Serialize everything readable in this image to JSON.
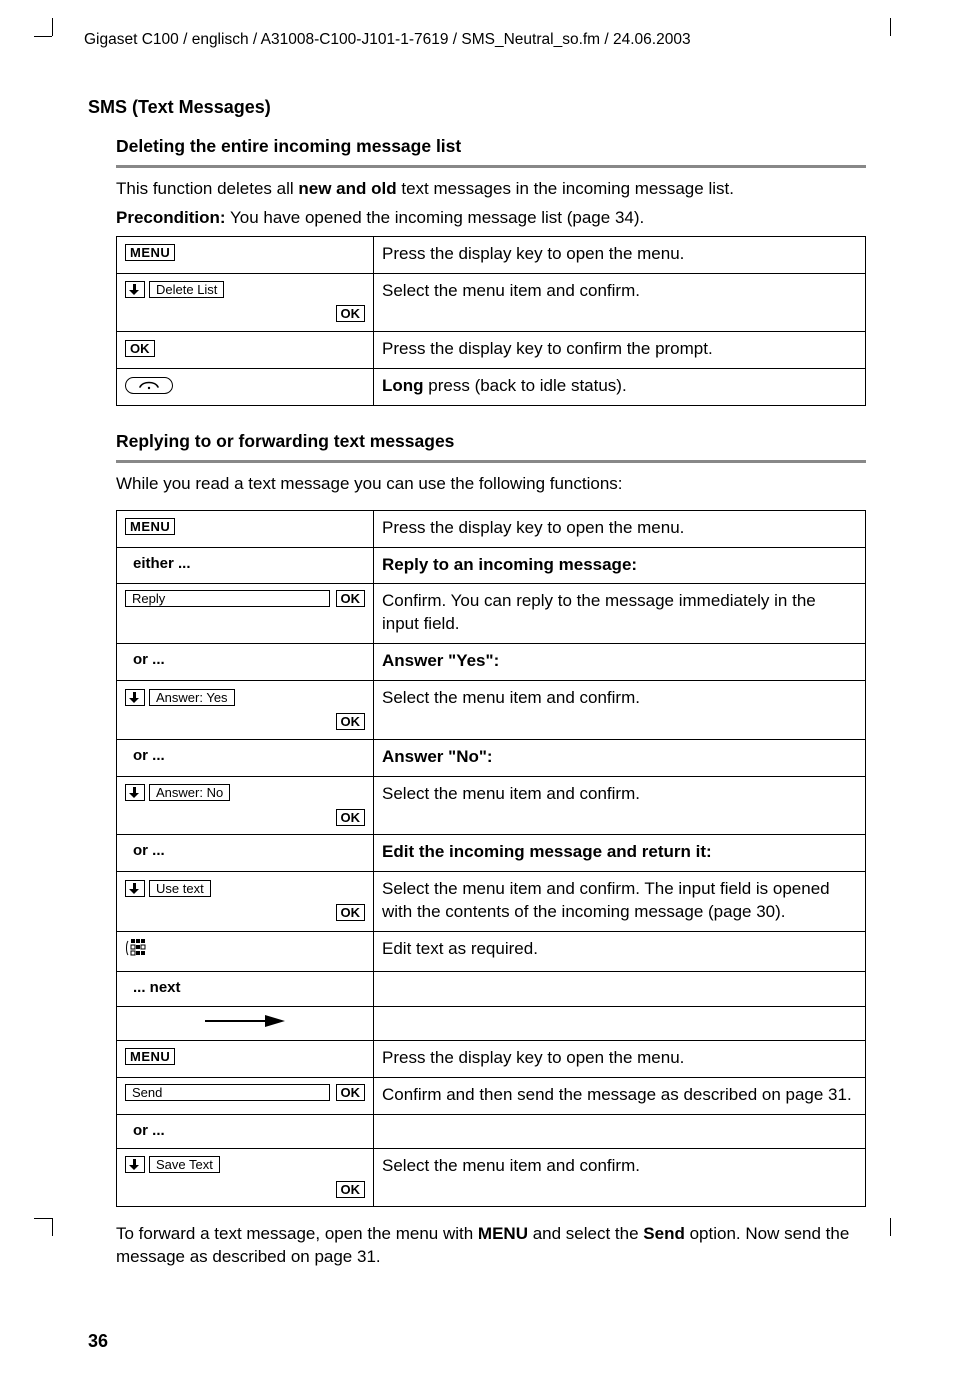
{
  "header": "Gigaset C100 / englisch / A31008-C100-J101-1-7619 / SMS_Neutral_so.fm / 24.06.2003",
  "section_title": "SMS (Text Messages)",
  "s1": {
    "heading": "Deleting the entire incoming message list",
    "intro_a": "This function deletes all ",
    "intro_b": "new and old",
    "intro_c": " text messages in the incoming message list.",
    "precond_label": "Precondition:",
    "precond_text": " You have opened the incoming message list (page 34).",
    "rows": [
      {
        "key_type": "menu",
        "desc": "Press the display key to open the menu."
      },
      {
        "key_type": "scroll_ok",
        "label": "Delete List",
        "desc": "Select the menu item and confirm."
      },
      {
        "key_type": "ok",
        "desc": "Press the display key to confirm the prompt."
      },
      {
        "key_type": "hangup",
        "desc_pre": "Long",
        "desc_post": " press (back to idle status)."
      }
    ]
  },
  "s2": {
    "heading": "Replying to or forwarding text messages",
    "intro": "While you read a text message you can use the following functions:",
    "rows": [
      {
        "left_type": "menu",
        "right": "Press the display key to open the menu."
      },
      {
        "left_type": "label",
        "left_text": "either ...",
        "right_bold": "Reply to an incoming message:"
      },
      {
        "left_type": "wide_ok",
        "left_label": "Reply",
        "right": "Confirm. You can reply to the message immediately in the input field."
      },
      {
        "left_type": "label",
        "left_text": "or ...",
        "right_bold": "Answer \"Yes\":"
      },
      {
        "left_type": "scroll_ok",
        "left_label": "Answer: Yes",
        "right": "Select the menu item and confirm."
      },
      {
        "left_type": "label",
        "left_text": "or ...",
        "right_bold": "Answer \"No\":"
      },
      {
        "left_type": "scroll_ok",
        "left_label": "Answer: No",
        "right": "Select the menu item and confirm."
      },
      {
        "left_type": "label",
        "left_text": "or ...",
        "right_bold": "Edit the incoming message and return it:"
      },
      {
        "left_type": "scroll_ok",
        "left_label": "Use text",
        "right": "Select the menu item and confirm. The input field is opened with the contents of the incoming message (page 30)."
      },
      {
        "left_type": "keypad",
        "right": "Edit text as required."
      },
      {
        "left_type": "label",
        "left_text": "... next",
        "right": ""
      },
      {
        "left_type": "arrow_right",
        "right": ""
      },
      {
        "left_type": "menu",
        "right": "Press the display key to open the menu."
      },
      {
        "left_type": "wide_ok",
        "left_label": "Send",
        "right": "Confirm and then send the message as described on page 31."
      },
      {
        "left_type": "label",
        "left_text": "or ...",
        "right": ""
      },
      {
        "left_type": "scroll_ok",
        "left_label": "Save Text",
        "right": "Select the menu item and confirm."
      }
    ],
    "outro_a": "To forward a text message, open the menu with ",
    "outro_b": "MENU",
    "outro_c": " and select the ",
    "outro_d": "Send",
    "outro_e": " option. Now send the message as described on page 31."
  },
  "keys": {
    "menu": "MENU",
    "ok": "OK"
  },
  "page_number": "36"
}
